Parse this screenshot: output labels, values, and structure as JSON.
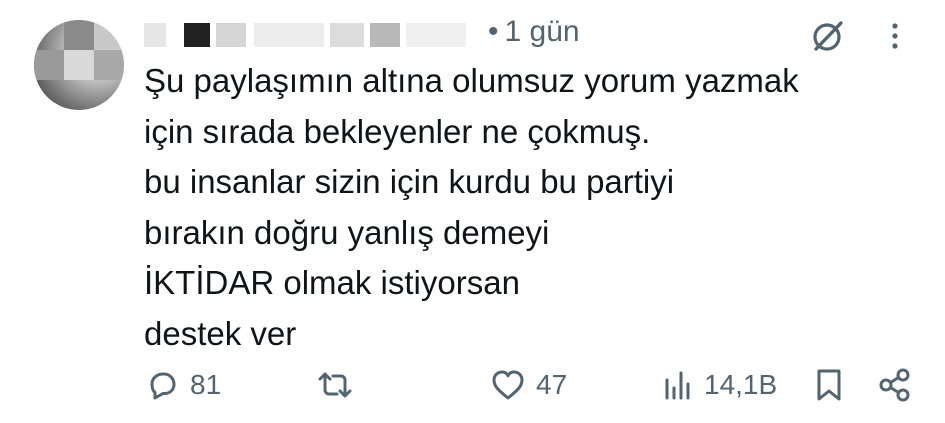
{
  "tweet": {
    "time": "1 gün",
    "separator": "•",
    "lines": [
      "Şu paylaşımın altına olumsuz yorum yazmak",
      "için sırada bekleyenler ne çokmuş.",
      "bu insanlar sizin için kurdu bu partiyi",
      "bırakın doğru yanlış demeyi",
      "İKTİDAR olmak istiyorsan",
      "destek ver"
    ]
  },
  "actions": {
    "replies": "81",
    "retweets": "",
    "likes": "47",
    "views": "14,1B"
  },
  "icons": {
    "header": [
      "grok-icon",
      "more-icon"
    ],
    "footer": [
      "reply-icon",
      "retweet-icon",
      "like-icon",
      "views-icon",
      "bookmark-icon",
      "share-icon"
    ]
  },
  "colors": {
    "text": "#0f1419",
    "secondary": "#536471",
    "background": "#ffffff"
  }
}
